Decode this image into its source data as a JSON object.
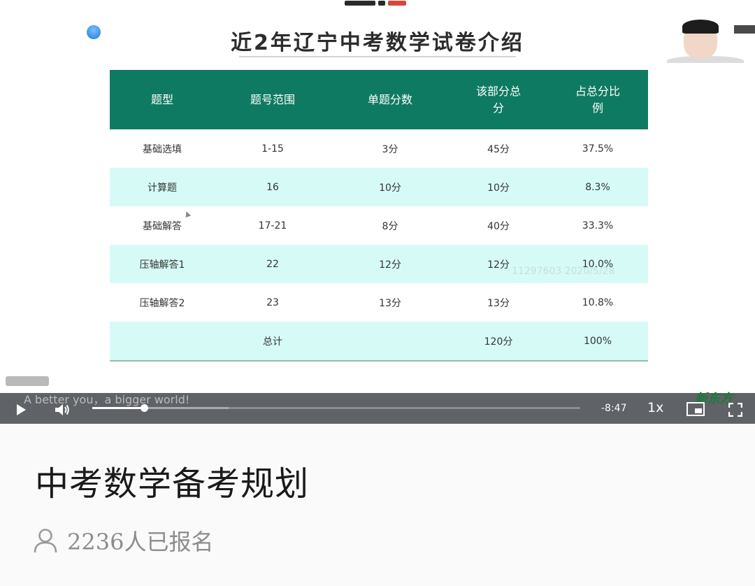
{
  "slide": {
    "title": "近2年辽宁中考数学试卷介绍",
    "table": {
      "headers": [
        "题型",
        "题号范围",
        "单题分数",
        "该部分总\n分",
        "占总分比\n例"
      ],
      "rows": [
        [
          "基础选填",
          "1-15",
          "3分",
          "45分",
          "37.5%"
        ],
        [
          "计算题",
          "16",
          "10分",
          "10分",
          "8.3%"
        ],
        [
          "基础解答",
          "17-21",
          "8分",
          "40分",
          "33.3%"
        ],
        [
          "压轴解答1",
          "22",
          "12分",
          "12分",
          "10.0%"
        ],
        [
          "压轴解答2",
          "23",
          "13分",
          "13分",
          "10.8%"
        ],
        [
          "",
          "总计",
          "",
          "120分",
          "100%"
        ]
      ]
    },
    "watermark": "11297603 2020/5/28",
    "slogan": "A better you，a bigger world!",
    "brand": "新东方"
  },
  "player": {
    "time_remaining": "-8:47",
    "speed": "1x",
    "progress_fraction": 0.106,
    "buffered_fraction": 0.28,
    "icons": [
      "play-icon",
      "volume-icon",
      "pip-icon",
      "fullscreen-icon"
    ]
  },
  "course": {
    "title": "中考数学备考规划",
    "enroll_count": "2236人已报名"
  },
  "colors": {
    "table_header": "#0f7a62",
    "table_alt_row": "#d6fbf7",
    "controls_bar": "#5f6266"
  }
}
